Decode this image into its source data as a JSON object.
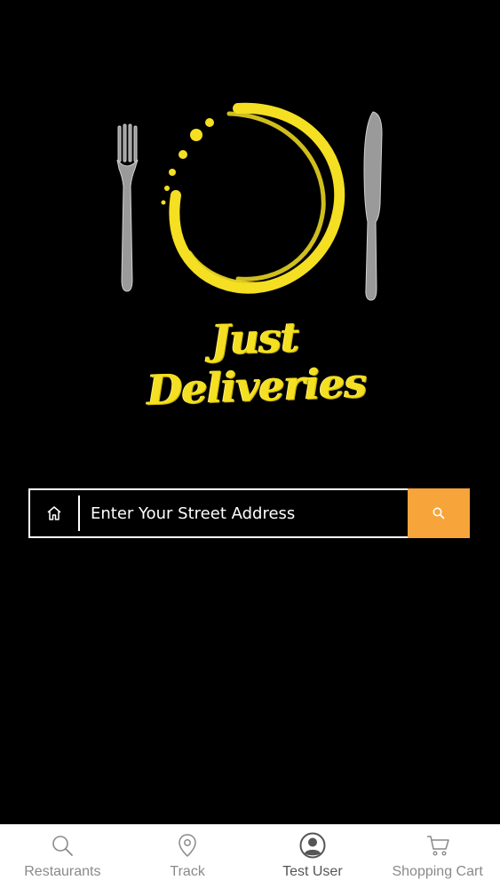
{
  "brand": {
    "name": "Just Deliveries",
    "accent_color": "#f4df22"
  },
  "search": {
    "placeholder": "Enter Your Street Address",
    "value": "",
    "button_color": "#f7a43a",
    "field_icon": "home-icon",
    "button_icon": "search-icon"
  },
  "tabs": [
    {
      "label": "Restaurants",
      "icon": "search-icon",
      "active": false
    },
    {
      "label": "Track",
      "icon": "location-pin-icon",
      "active": false
    },
    {
      "label": "Test User",
      "icon": "user-avatar-icon",
      "active": true
    },
    {
      "label": "Shopping Cart",
      "icon": "shopping-cart-icon",
      "active": false
    }
  ]
}
